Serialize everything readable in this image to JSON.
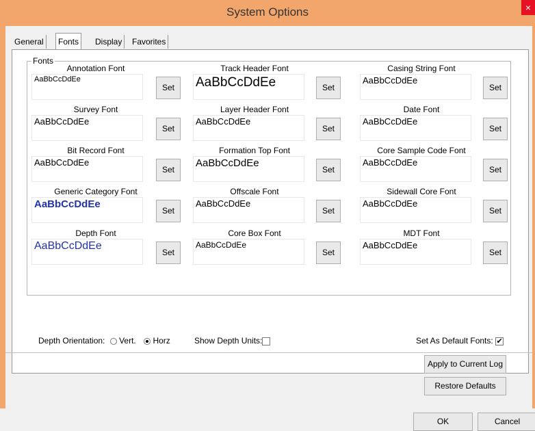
{
  "window": {
    "title": "System Options",
    "close_label": "×"
  },
  "tabs": [
    {
      "label": "General",
      "active": false
    },
    {
      "label": "Fonts",
      "active": true
    },
    {
      "label": "Display",
      "active": false
    },
    {
      "label": "Favorites",
      "active": false
    }
  ],
  "fonts_group": {
    "label": "Fonts",
    "set_label": "Set",
    "items": [
      {
        "label": "Annotation Font",
        "sample": "AaBbCcDdEe"
      },
      {
        "label": "Track Header Font",
        "sample": "AaBbCcDdEe"
      },
      {
        "label": "Casing String Font",
        "sample": "AaBbCcDdEe"
      },
      {
        "label": "Survey Font",
        "sample": "AaBbCcDdEe"
      },
      {
        "label": "Layer Header Font",
        "sample": "AaBbCcDdEe"
      },
      {
        "label": "Date Font",
        "sample": "AaBbCcDdEe"
      },
      {
        "label": "Bit Record Font",
        "sample": "AaBbCcDdEe"
      },
      {
        "label": "Formation Top Font",
        "sample": "AaBbCcDdEe"
      },
      {
        "label": "Core Sample Code Font",
        "sample": "AaBbCcDdEe"
      },
      {
        "label": "Generic Category Font",
        "sample": "AaBbCcDdEe",
        "color": "#2233aa"
      },
      {
        "label": "Offscale Font",
        "sample": "AaBbCcDdEe"
      },
      {
        "label": "Sidewall Core Font",
        "sample": "AaBbCcDdEe"
      },
      {
        "label": "Depth Font",
        "sample": "AaBbCcDdEe",
        "color": "#2233aa"
      },
      {
        "label": "Core Box Font",
        "sample": "AaBbCcDdEe"
      },
      {
        "label": "MDT Font",
        "sample": "AaBbCcDdEe"
      }
    ]
  },
  "depth_orientation": {
    "label": "Depth Orientation:",
    "vert_label": "Vert.",
    "horz_label": "Horz",
    "selected": "Horz"
  },
  "show_depth_units": {
    "label": "Show Depth Units:",
    "checked": false
  },
  "set_as_default_fonts": {
    "label": "Set As Default Fonts:",
    "checked": true,
    "check_mark": "✔"
  },
  "buttons": {
    "apply": "Apply to Current Log",
    "restore": "Restore Defaults",
    "ok": "OK",
    "cancel": "Cancel"
  }
}
